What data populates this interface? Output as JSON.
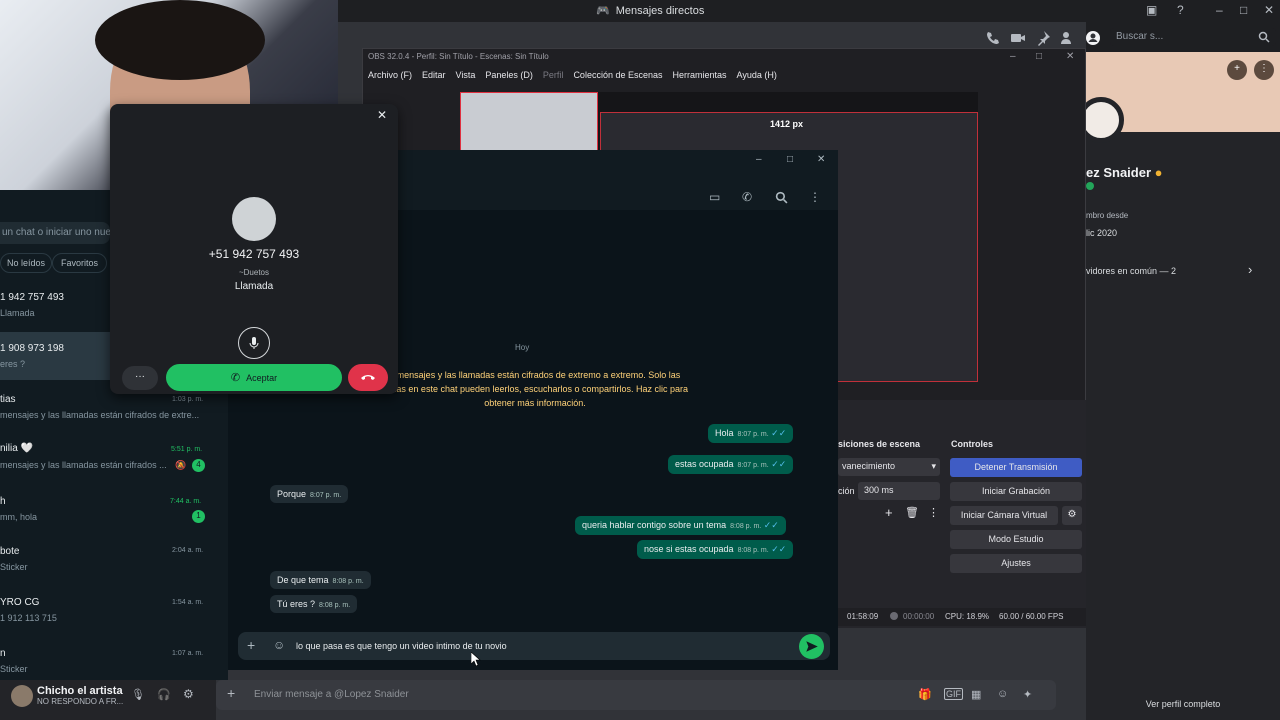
{
  "discord": {
    "window_title": "Mensajes directos",
    "search_placeholder": "Buscar s...",
    "profile": {
      "name": "ez Snaider",
      "member_since_label": "mbro desde",
      "member_since": "lic 2020",
      "servers_in_common": "vidores en común — 2",
      "view_full_profile": "Ver perfil completo"
    },
    "user": {
      "name": "Chicho el artista",
      "status": "NO RESPONDO A FR..."
    },
    "message_placeholder": "Enviar mensaje a @Lopez Snaider"
  },
  "obs": {
    "title": "OBS 32.0.4 - Perfil: Sin Título - Escenas: Sin Título",
    "menu": [
      "Archivo (F)",
      "Editar",
      "Vista",
      "Paneles (D)",
      "Perfil",
      "Colección de Escenas",
      "Herramientas",
      "Ayuda (H)"
    ],
    "preview_size_label": "1412 px",
    "scene_transitions_title": "siciones de escena",
    "transition": "vanecimiento",
    "duration_label": "ción",
    "duration_value": "300 ms",
    "controls_title": "Controles",
    "buttons": [
      "Detener Transmisión",
      "Iniciar Grabación",
      "Iniciar Cámara Virtual",
      "Modo Estudio",
      "Ajustes"
    ],
    "status": {
      "stream_time": "01:58:09",
      "rec_time": "00:00:00",
      "cpu": "CPU: 18.9%",
      "fps": "60.00 / 60.00 FPS"
    }
  },
  "whatsapp": {
    "search_placeholder": "un chat o iniciar uno nue",
    "filters": [
      "No leídos",
      "Favoritos"
    ],
    "chats": [
      {
        "title": "1 942 757 493",
        "sub": "Llamada",
        "time": ""
      },
      {
        "title": "1 908 973 198",
        "sub": "eres ?",
        "time": ""
      },
      {
        "title": "tias",
        "sub": "mensajes y las llamadas están cifrados de extre...",
        "time": "1:03 p. m."
      },
      {
        "title": "nilia 🤍",
        "sub": "mensajes y las llamadas están cifrados ...",
        "time": "5:51 p. m.",
        "badge": "4"
      },
      {
        "title": "h",
        "sub": "mm, hola",
        "time": "7:44 a. m.",
        "badge": "1"
      },
      {
        "title": "bote",
        "sub": "Sticker",
        "time": "2:04 a. m."
      },
      {
        "title": "YRO CG",
        "sub": "1 912 113 715",
        "time": "1:54 a. m."
      },
      {
        "title": "n",
        "sub": "Sticker",
        "time": "1:07 a. m."
      }
    ],
    "today_label": "Hoy",
    "encryption_notice": "s mensajes y las llamadas están cifrados de extremo a extremo. Solo las sonas en este chat pueden leerlos, escucharlos o compartirlos. Haz clic para obtener más información.",
    "messages": [
      {
        "dir": "out",
        "text": "Hola",
        "time": "8:07 p. m."
      },
      {
        "dir": "out",
        "text": "estas ocupada",
        "time": "8:07 p. m."
      },
      {
        "dir": "in",
        "text": "Porque",
        "time": "8:07 p. m."
      },
      {
        "dir": "out",
        "text": "queria hablar contigo sobre un tema",
        "time": "8:08 p. m."
      },
      {
        "dir": "out",
        "text": "nose si estas ocupada",
        "time": "8:08 p. m."
      },
      {
        "dir": "in",
        "text": "De que tema",
        "time": "8:08 p. m."
      },
      {
        "dir": "in",
        "text": "Tú eres ?",
        "time": "8:08 p. m."
      }
    ],
    "composer_text": "lo que pasa es que tengo un video intimo de tu novio",
    "call": {
      "number": "+51 942 757 493",
      "tag": "~Duetos",
      "type": "Llamada",
      "more": "···",
      "accept": "Aceptar"
    }
  },
  "colors": {
    "wa_green": "#21c063",
    "wa_out_bubble": "#005c4b",
    "obs_accent": "#3f5cc4",
    "decline_red": "#e0334a"
  }
}
